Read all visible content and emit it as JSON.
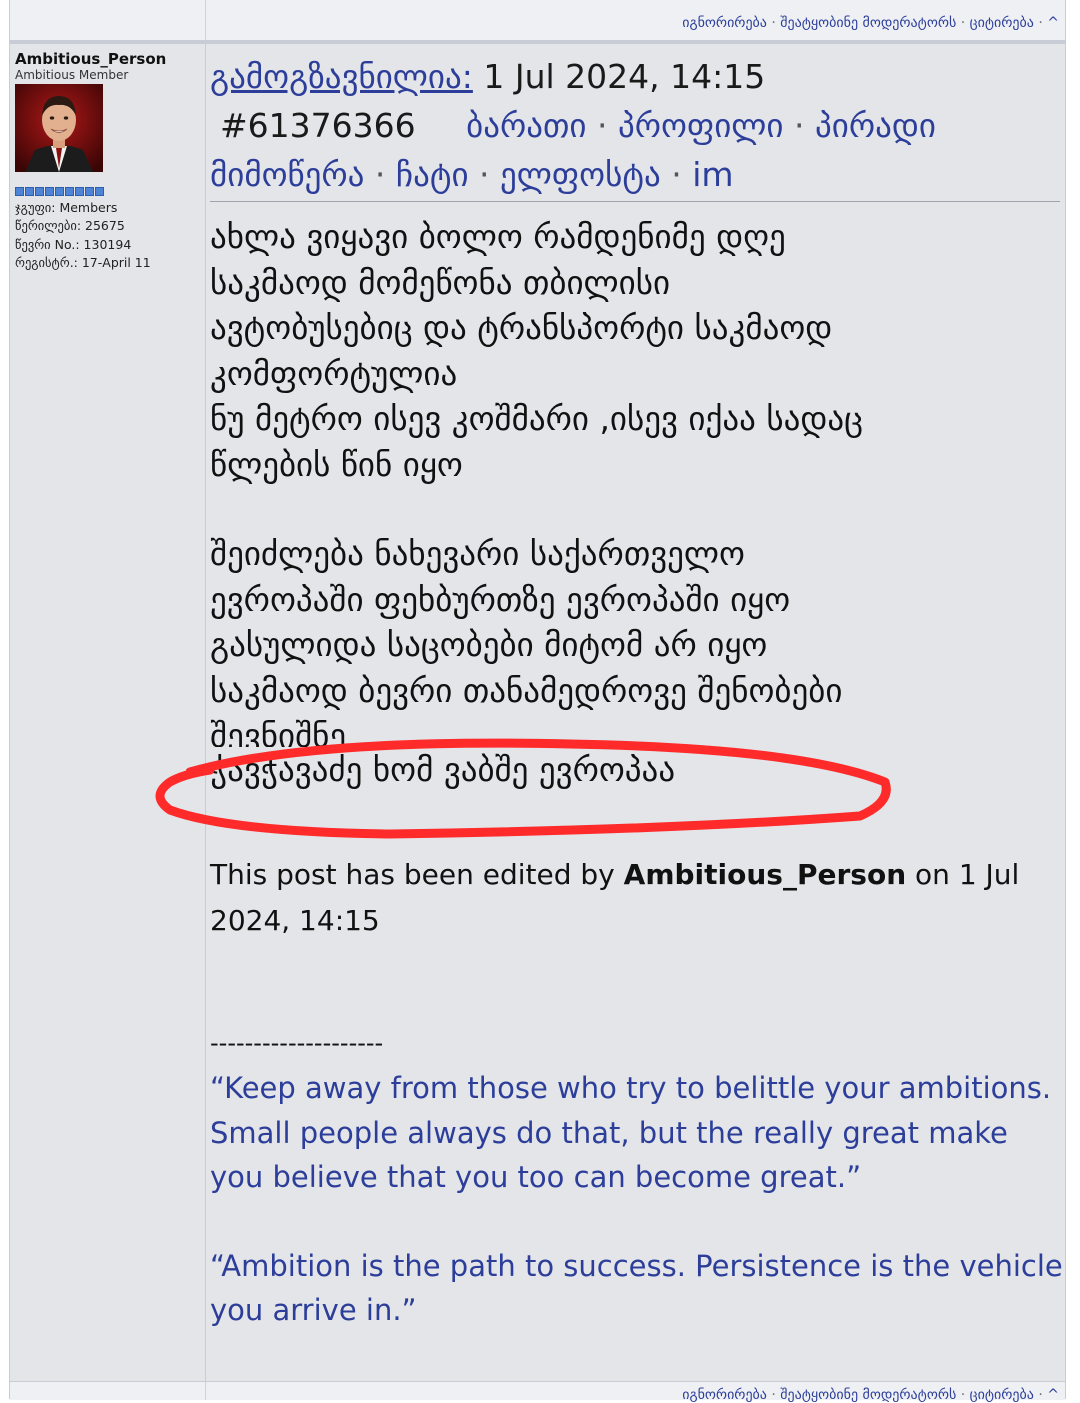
{
  "top_bar": {
    "links": [
      "იგნორირება",
      "შეატყობინე მოდერატორს",
      "ციტირება",
      "^"
    ]
  },
  "user": {
    "name": "Ambitious_Person",
    "title": "Ambitious Member",
    "rank_pips": 8,
    "group": "ჯგუფი: Members",
    "posts": "წერილები: 25675",
    "member_no": "წევრი No.: 130194",
    "registered": "რეგისტრ.: 17-April 11"
  },
  "post": {
    "sent_label": "გამოგზავნილია:",
    "date": "1 Jul 2024, 14:15",
    "id": "#61376366",
    "actions": [
      "ბარათი",
      "პროფილი",
      "პირადი მიმოწერა",
      "ჩატი",
      "ელფოსტა",
      "im"
    ],
    "body_lines": [
      "ახლა ვიყავი ბოლო რამდენიმე დღე",
      "საკმაოდ მომეწონა თბილისი",
      "ავტობუსებიც და ტრანსპორტი საკმაოდ",
      "კომფორტულია",
      "ნუ მეტრო ისევ კოშმარი ,ისევ იქაა სადაც",
      "წლების წინ იყო",
      "",
      "შეიძლება ნახევარი საქართველო",
      "ევროპაში ფეხბურთზე ევროპაში იყო",
      "გასულიდა საცობები მიტომ არ იყო",
      "საკმაოდ ბევრი თანამედროვე შენობები",
      "შევნიშნე",
      "ჭავჭავაძე ხომ ვაბშე ევროპაა"
    ],
    "edited_prefix": "This post has been edited by",
    "edited_by": "Ambitious_Person",
    "edited_suffix": "on 1 Jul 2024, 14:15"
  },
  "signature": {
    "dashes": "--------------------",
    "quote1": "“Keep away from those who try to belittle your ambitions. Small people always do that, but the really great make you believe that you too can become great.”",
    "quote2": "“Ambition is the path to success. Persistence is the vehicle you arrive in.”"
  },
  "colors": {
    "link": "#2c3e9a",
    "annotation": "#ff2a2a",
    "background": "#e3e5e8"
  }
}
